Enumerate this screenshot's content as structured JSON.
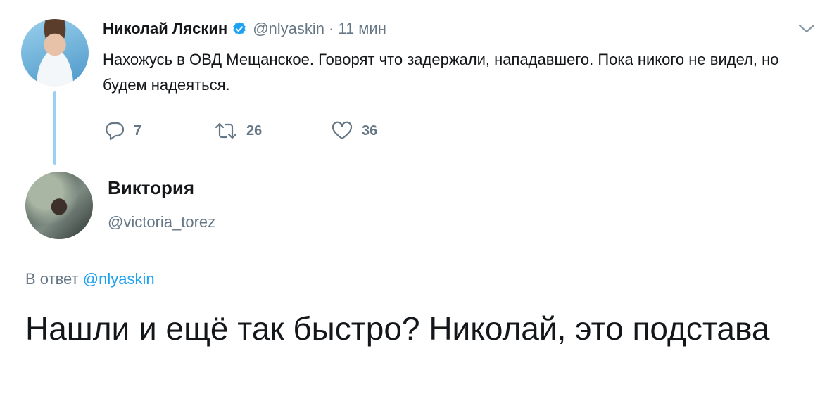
{
  "parent_tweet": {
    "author_name": "Николай Ляскин",
    "verified_icon": "verified-badge-icon",
    "handle": "@nlyaskin",
    "separator": "·",
    "time": "11 мин",
    "text": "Нахожусь в ОВД Мещанское. Говорят что задержали, нападавшего. Пока никого не видел, но будем надеяться.",
    "actions": {
      "reply_count": "7",
      "retweet_count": "26",
      "like_count": "36"
    }
  },
  "reply_tweet": {
    "author_name": "Виктория",
    "handle": "@victoria_torez",
    "reply_prefix": "В ответ",
    "reply_to": "@nlyaskin",
    "text": "Нашли и ещё так быстро? Николай, это подстава"
  },
  "colors": {
    "link": "#1da1f2",
    "secondary_text": "#657786",
    "primary_text": "#14171a",
    "thread_line": "#9ad1f3"
  }
}
